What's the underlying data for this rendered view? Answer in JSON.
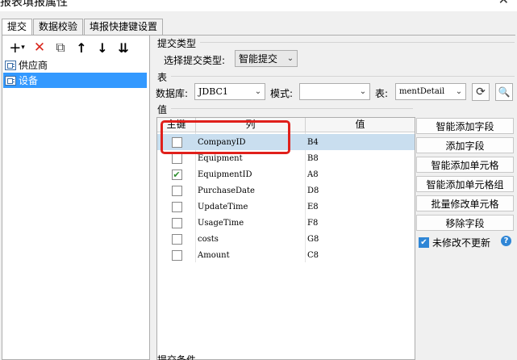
{
  "window": {
    "title": "报表填报属性",
    "close_glyph": "✕"
  },
  "tabs": [
    {
      "label": "提交",
      "active": true
    },
    {
      "label": "数据校验",
      "active": false
    },
    {
      "label": "填报快捷键设置",
      "active": false
    }
  ],
  "toolbar": {
    "add_glyph": "+",
    "add_dropdown_glyph": "▾",
    "delete_glyph": "✕",
    "copy_glyph": "⧉",
    "up_glyph": "↑",
    "down_glyph": "↓",
    "more_glyph": "⇊"
  },
  "tree": {
    "items": [
      {
        "label": "供应商",
        "selected": false
      },
      {
        "label": "设备",
        "selected": true
      }
    ]
  },
  "submit_type": {
    "section_label": "提交类型",
    "field_label": "选择提交类型:",
    "value": "智能提交"
  },
  "table_section": {
    "section_label": "表",
    "db_label": "数据库:",
    "db_value": "JDBC1",
    "schema_label": "模式:",
    "schema_value": "",
    "table_label": "表:",
    "table_value": "mentDetail"
  },
  "value_section": {
    "section_label": "值",
    "columns": [
      "主键",
      "列",
      "值"
    ],
    "rows": [
      {
        "key": false,
        "column": "CompanyID",
        "value": "B4"
      },
      {
        "key": false,
        "column": "Equipment",
        "value": "B8"
      },
      {
        "key": true,
        "column": "EquipmentID",
        "value": "A8"
      },
      {
        "key": false,
        "column": "PurchaseDate",
        "value": "D8"
      },
      {
        "key": false,
        "column": "UpdateTime",
        "value": "E8"
      },
      {
        "key": false,
        "column": "UsageTime",
        "value": "F8"
      },
      {
        "key": false,
        "column": "costs",
        "value": "G8"
      },
      {
        "key": false,
        "column": "Amount",
        "value": "C8"
      }
    ]
  },
  "actions": {
    "smart_add_field": "智能添加字段",
    "add_field": "添加字段",
    "smart_add_cell": "智能添加单元格",
    "smart_add_cell_group": "智能添加单元格组",
    "batch_modify_cell": "批量修改单元格",
    "remove_field": "移除字段",
    "unmodified_no_update": "未修改不更新",
    "unmodified_checked": true
  },
  "submit_condition": {
    "section_label": "提交条件"
  },
  "colors": {
    "accent": "#3399ff",
    "highlight": "#e0201b",
    "selected_row": "#c9deef"
  }
}
